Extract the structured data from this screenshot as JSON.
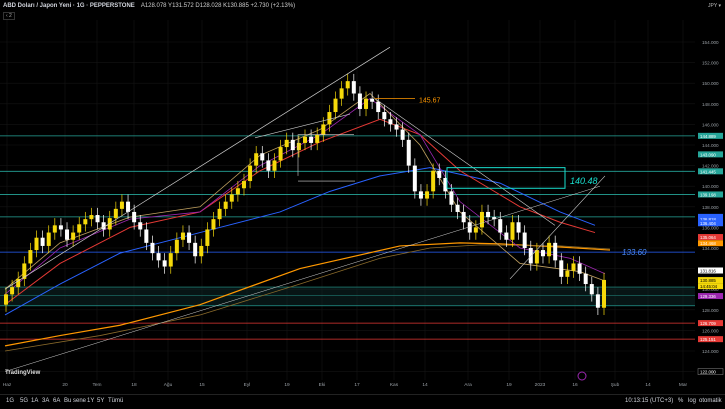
{
  "header": {
    "symbol": "ABD Doları / Japon Yeni · 1G · PEPPERSTONE",
    "ohlc": "A128.078 Y131.572 D128.028 K130.885 +2.730 (+2.13%)",
    "sub": "‹ 2",
    "currency": "JPY ▾"
  },
  "logo": "TradingView",
  "price_axis": {
    "ticks": [
      "154.000",
      "152.000",
      "150.000",
      "148.000",
      "146.000",
      "144.000",
      "142.000",
      "140.000",
      "138.000",
      "136.000",
      "134.000",
      "132.000",
      "130.000",
      "128.000",
      "126.000",
      "124.000",
      "122.000"
    ],
    "tags": [
      {
        "text": "144.889",
        "price": 144.889,
        "color": "#26a69a"
      },
      {
        "text": "143.090",
        "price": 143.09,
        "color": "#26a69a"
      },
      {
        "text": "141.445",
        "price": 141.445,
        "color": "#26a69a"
      },
      {
        "text": "139.198",
        "price": 139.198,
        "color": "#26a69a"
      },
      {
        "text": "137.021",
        "price": 137.021,
        "color": "#2962ff"
      },
      {
        "text": "136.818",
        "price": 136.818,
        "color": "#2962ff"
      },
      {
        "text": "136.404",
        "price": 136.404,
        "color": "#2962ff"
      },
      {
        "text": "135.064",
        "price": 135.064,
        "color": "#e53935"
      },
      {
        "text": "134.468",
        "price": 134.468,
        "color": "#ff9800"
      },
      {
        "text": "131.816",
        "price": 131.816,
        "color": "#ffffff"
      },
      {
        "text": "130.885",
        "price": 130.885,
        "color": "#f5d90a"
      },
      {
        "text": "14:45:04",
        "price": 130.3,
        "color": "#f5d90a"
      },
      {
        "text": "129.336",
        "price": 129.336,
        "color": "#9c27b0"
      },
      {
        "text": "126.709",
        "price": 126.709,
        "color": "#e53935"
      },
      {
        "text": "125.151",
        "price": 125.151,
        "color": "#e53935"
      },
      {
        "text": "122.000",
        "price": 122.0,
        "color": "#000000"
      }
    ]
  },
  "time_axis": [
    "Haz",
    "20",
    "Tem",
    "18",
    "Ağu",
    "15",
    "Eyl",
    "19",
    "Eki",
    "17",
    "Kas",
    "14",
    "Ara",
    "19",
    "2023",
    "16",
    "Şub",
    "14",
    "Mar"
  ],
  "annotations": {
    "peak_label": "145.67",
    "box_label": "140.48",
    "mid_label": "133.60"
  },
  "bottom": {
    "ranges": [
      "1G",
      "5G",
      "1A",
      "3A",
      "6A",
      "Bu sene",
      "1Y",
      "5Y",
      "Tümü"
    ],
    "time": "10:13:15 (UTC+3)",
    "modes": [
      "%",
      "log",
      "otomatik"
    ]
  },
  "colors": {
    "up": "#f5d90a",
    "down": "#ffffff",
    "green": "#26a69a",
    "blue": "#2962ff",
    "orange": "#ff9800",
    "red": "#e53935",
    "purple": "#9c27b0"
  }
}
